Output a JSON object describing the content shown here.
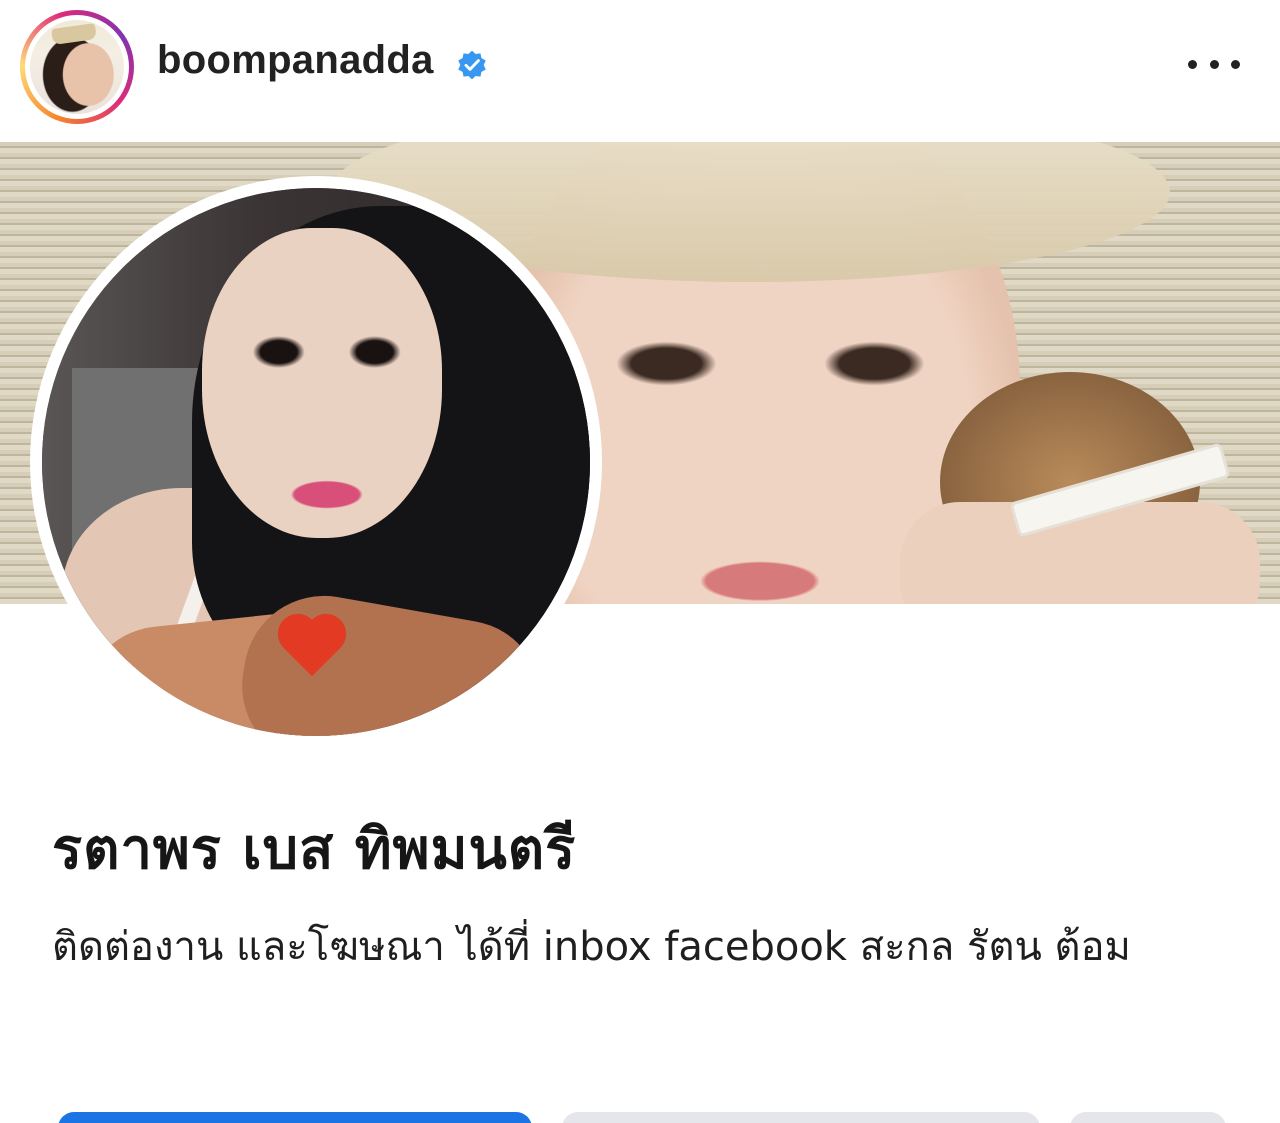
{
  "post_header": {
    "username": "boompanadda",
    "verified_icon": "verified-badge-icon",
    "more_icon": "more-options-icon",
    "accent_color": "#3897f0"
  },
  "embedded_screenshot": {
    "profile": {
      "name": "รตาพร เบส ทิพมนตรี",
      "bio": "ติดต่องาน และโฆษณา ได้ที่ inbox facebook สะกล รัตน ต้อม"
    },
    "buttons": {
      "primary_color": "#1b74e4",
      "secondary_color": "#e4e6eb"
    }
  }
}
